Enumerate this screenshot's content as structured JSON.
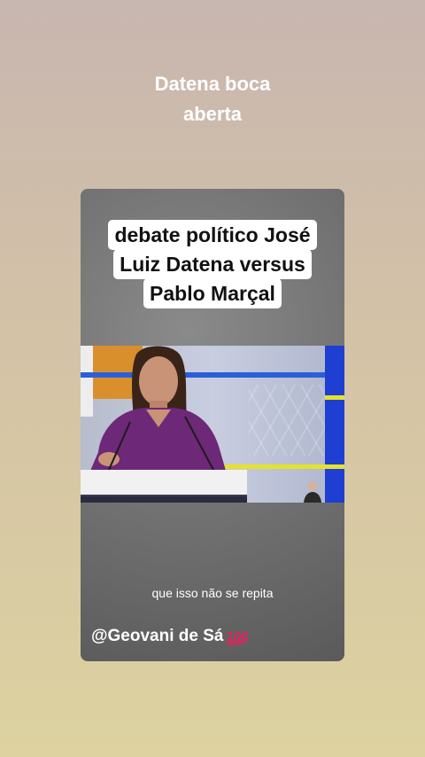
{
  "overlay_caption": {
    "line1": "Datena boca",
    "line2": "aberta"
  },
  "video_card": {
    "title_lines": [
      "debate político José",
      "Luiz Datena versus",
      "Pablo Marçal"
    ],
    "subtitle": "que isso não se repita",
    "handle": "@Geovani de Sá",
    "handle_emoji_icon": "hundred-points-icon"
  },
  "colors": {
    "background_top": "#c8b6b0",
    "background_bottom": "#ddd2a0",
    "card_background": "#6f6f6f",
    "title_box": "#ffffff",
    "emoji_red": "#e0245e"
  }
}
